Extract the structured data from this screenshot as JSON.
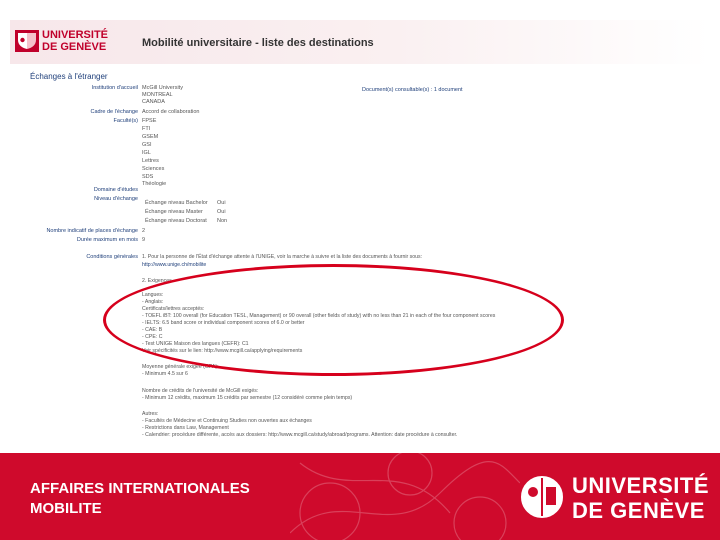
{
  "header": {
    "logo_line1": "UNIVERSITÉ",
    "logo_line2": "DE GENÈVE",
    "page_title": "Mobilité universitaire - liste des destinations"
  },
  "section_title": "Échanges à l'étranger",
  "documents_link": "Document(s) consultable(s) : 1 document",
  "fields": {
    "institution_label": "Institution d'accueil",
    "institution_lines": [
      "McGill University",
      "MONTREAL",
      "CANADA"
    ],
    "cadre_label": "Cadre de l'échange",
    "cadre_value": "Accord de collaboration",
    "faculties_label": "Faculté(s)",
    "faculties": [
      "FPSE",
      "FTI",
      "GSEM",
      "GSI",
      "IGL",
      "Lettres",
      "Sciences",
      "SDS",
      "Théologie"
    ],
    "domain_label": "Domaine d'études",
    "level_label": "Niveau d'échange",
    "levels": [
      {
        "label": "Échange niveau Bachelor",
        "value": "Oui"
      },
      {
        "label": "Échange niveau Master",
        "value": "Oui"
      },
      {
        "label": "Échange niveau Doctorat",
        "value": "Non"
      }
    ],
    "places_label": "Nombre indicatif de places d'échange",
    "places_value": "2",
    "duration_label": "Durée maximum en mois",
    "duration_value": "9",
    "conditions_label": "Conditions générales"
  },
  "conditions_lines": [
    "1. Pour la personne de l'État d'échange attente à l'UNIGE, voir la marche à suivre et la liste des documents à fournir sous:",
    "http://www.unige.ch/mobilite",
    "2. Exigences",
    "Langues:",
    "- Anglais:",
    "Certificats/lettres acceptés:",
    "- TOEFL iBT: 100 overall (for Education TESL, Management) or 90 overall (other fields of study) with no less than 21 in each of the four component scores",
    "- IELTS: 6.5 band score or individual component scores of 6.0 or better",
    "- CAE: B",
    "- CPE: C",
    "- Test UNIGE Maison des langues (CEFR): C1",
    "Voir spécificités sur le lien: http://www.mcgill.ca/applying/requirements",
    "Moyenne générale exigée (GPA):",
    "- Minimum 4.5 sur 6",
    "Nombre de crédits de l'université de McGill exigés:",
    "- Minimum 12 crédits, maximum 15 crédits par semestre (12 considéré comme plein temps)",
    "Autres:",
    "- Facultés de Médecine et Continuing Studies non ouvertes aux échanges",
    "- Restrictions dans Law, Management",
    "- Calendrier: procédure différente, accès aux dossiers: http://www.mcgill.ca/study/abroad/programs. Attention: date procédure à consulter."
  ],
  "footer": {
    "line1": "AFFAIRES INTERNATIONALES",
    "line2": "MOBILITE",
    "uni_line1": "UNIVERSITÉ",
    "uni_line2": "DE GENÈVE"
  },
  "colors": {
    "brand_red": "#cf0a2c",
    "annotation_red": "#d6001c",
    "label_blue": "#1f3f7a"
  }
}
